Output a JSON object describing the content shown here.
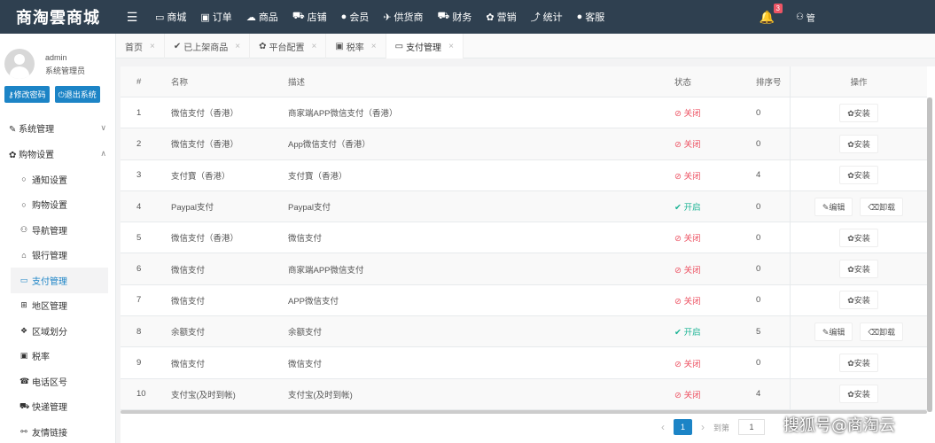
{
  "brand": "商淘雲商城",
  "nav": [
    {
      "icon": "monitor-icon",
      "glyph": "▭",
      "label": "商城"
    },
    {
      "icon": "shopping-bag-icon",
      "glyph": "▣",
      "label": "订单"
    },
    {
      "icon": "cloud-icon",
      "glyph": "☁",
      "label": "商品"
    },
    {
      "icon": "cart-icon",
      "glyph": "⛟",
      "label": "店铺"
    },
    {
      "icon": "user-icon",
      "glyph": "●",
      "label": "会员"
    },
    {
      "icon": "rocket-icon",
      "glyph": "✈",
      "label": "供货商"
    },
    {
      "icon": "truck-icon",
      "glyph": "⛟",
      "label": "财务"
    },
    {
      "icon": "gear-icon",
      "glyph": "✿",
      "label": "营销"
    },
    {
      "icon": "chart-icon",
      "glyph": "⤴",
      "label": "统计"
    },
    {
      "icon": "chat-icon",
      "glyph": "●",
      "label": "客服"
    }
  ],
  "notifications": {
    "count": "3"
  },
  "topbar_user": "管",
  "profile": {
    "name": "admin",
    "role": "系统管理员",
    "change_pwd": "修改密码",
    "logout": "退出系统"
  },
  "sidebar": {
    "sections": [
      {
        "label": "系统管理",
        "icon": "wrench-icon"
      },
      {
        "label": "购物设置",
        "icon": "gear-icon"
      }
    ],
    "items": [
      {
        "label": "通知设置",
        "icon": "circle-icon",
        "glyph": "○"
      },
      {
        "label": "购物设置",
        "icon": "circle-icon",
        "glyph": "○"
      },
      {
        "label": "导航管理",
        "icon": "binoculars-icon",
        "glyph": "⚇"
      },
      {
        "label": "银行管理",
        "icon": "bank-icon",
        "glyph": "⌂"
      },
      {
        "label": "支付管理",
        "icon": "credit-card-icon",
        "glyph": "▭"
      },
      {
        "label": "地区管理",
        "icon": "sitemap-icon",
        "glyph": "⊞"
      },
      {
        "label": "区域划分",
        "icon": "cubes-icon",
        "glyph": "❖"
      },
      {
        "label": "税率",
        "icon": "money-icon",
        "glyph": "▣"
      },
      {
        "label": "电话区号",
        "icon": "phone-icon",
        "glyph": "☎"
      },
      {
        "label": "快递管理",
        "icon": "truck-icon",
        "glyph": "⛟"
      },
      {
        "label": "友情链接",
        "icon": "link-icon",
        "glyph": "⚯"
      }
    ]
  },
  "tabs": [
    {
      "label": "首页",
      "icon": ""
    },
    {
      "label": "已上架商品",
      "icon": "✔"
    },
    {
      "label": "平台配置",
      "icon": "✿"
    },
    {
      "label": "税率",
      "icon": "▣"
    },
    {
      "label": "支付管理",
      "icon": "▭"
    }
  ],
  "table": {
    "headers": {
      "no": "#",
      "name": "名称",
      "desc": "描述",
      "status": "状态",
      "sort": "排序号",
      "op": "操作"
    },
    "status_labels": {
      "off": "关闭",
      "on": "开启"
    },
    "op_labels": {
      "install": "安装",
      "edit": "编辑",
      "uninstall": "卸载"
    },
    "rows": [
      {
        "no": "1",
        "name": "微信支付（香港）",
        "desc": "商家端APP微信支付（香港）",
        "status": "off",
        "sort": "0"
      },
      {
        "no": "2",
        "name": "微信支付（香港）",
        "desc": "App微信支付（香港）",
        "status": "off",
        "sort": "0"
      },
      {
        "no": "3",
        "name": "支付寶（香港）",
        "desc": "支付寶（香港）",
        "status": "off",
        "sort": "4"
      },
      {
        "no": "4",
        "name": "Paypal支付",
        "desc": "Paypal支付",
        "status": "on",
        "sort": "0"
      },
      {
        "no": "5",
        "name": "微信支付（香港）",
        "desc": "微信支付",
        "status": "off",
        "sort": "0"
      },
      {
        "no": "6",
        "name": "微信支付",
        "desc": "商家端APP微信支付",
        "status": "off",
        "sort": "0"
      },
      {
        "no": "7",
        "name": "微信支付",
        "desc": "APP微信支付",
        "status": "off",
        "sort": "0"
      },
      {
        "no": "8",
        "name": "余额支付",
        "desc": "余额支付",
        "status": "on",
        "sort": "5"
      },
      {
        "no": "9",
        "name": "微信支付",
        "desc": "微信支付",
        "status": "off",
        "sort": "0"
      },
      {
        "no": "10",
        "name": "支付宝(及时到帐)",
        "desc": "支付宝(及时到帐)",
        "status": "off",
        "sort": "4"
      }
    ]
  },
  "pager": {
    "current": "1",
    "goto_label": "到第",
    "goto_value": "1"
  },
  "watermark": "搜狐号@商淘云",
  "colors": {
    "topbar": "#2f4050",
    "primary": "#1c84c6",
    "danger": "#ed5565",
    "success": "#1ab394"
  }
}
